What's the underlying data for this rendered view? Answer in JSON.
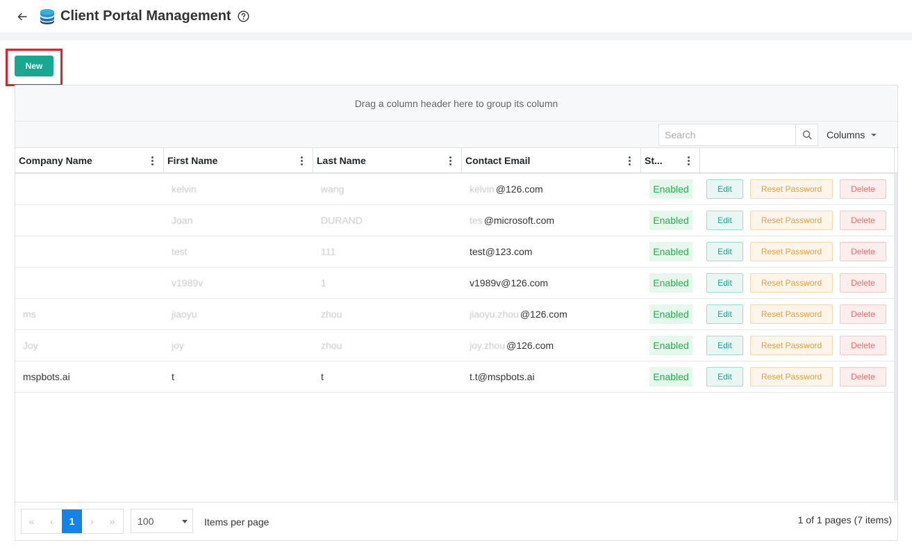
{
  "header": {
    "title": "Client Portal Management",
    "back_icon": "arrow-left-icon",
    "app_icon": "database-icon",
    "help_icon": "question-circle-icon"
  },
  "toolbar": {
    "new_label": "New"
  },
  "grid": {
    "group_hint": "Drag a column header here to group its column",
    "search_placeholder": "Search",
    "columns_label": "Columns",
    "headers": [
      "Company Name",
      "First Name",
      "Last Name",
      "Contact Email",
      "St..."
    ],
    "rows": [
      {
        "company": "",
        "first": "kelvin",
        "last": "wang",
        "email_hidden": "kelvin",
        "email": "@126.com",
        "status": "Enabled"
      },
      {
        "company": "",
        "first": "Joan",
        "last": "DURAND",
        "email_hidden": "tes",
        "email": "@microsoft.com",
        "status": "Enabled"
      },
      {
        "company": "",
        "first": "test",
        "last": "111",
        "email_hidden": "",
        "email": "test@123.com",
        "status": "Enabled"
      },
      {
        "company": "",
        "first": "v1989v",
        "last": "1",
        "email_hidden": "",
        "email": "v1989v@126.com",
        "status": "Enabled"
      },
      {
        "company": "ms",
        "first": "jiaoyu",
        "last": "zhou",
        "email_hidden": "jiaoyu.zhou",
        "email": "@126.com",
        "status": "Enabled"
      },
      {
        "company": "Joy",
        "first": "joy",
        "last": "zhou",
        "email_hidden": "joy.zhou",
        "email": "@126.com",
        "status": "Enabled"
      },
      {
        "company": "mspbots.ai",
        "first": "t",
        "last": "t",
        "email_hidden": "",
        "email": "t.t@mspbots.ai",
        "status": "Enabled"
      }
    ],
    "actions": {
      "edit": "Edit",
      "reset": "Reset Password",
      "delete": "Delete"
    }
  },
  "pager": {
    "current_page": "1",
    "page_size": "100",
    "per_page_label": "Items per page",
    "info": "1 of 1 pages (7 items)"
  },
  "colors": {
    "primary": "#17a88f",
    "highlight": "#d9232d",
    "enabled": "#22b14c",
    "active_page": "#1383e8"
  }
}
